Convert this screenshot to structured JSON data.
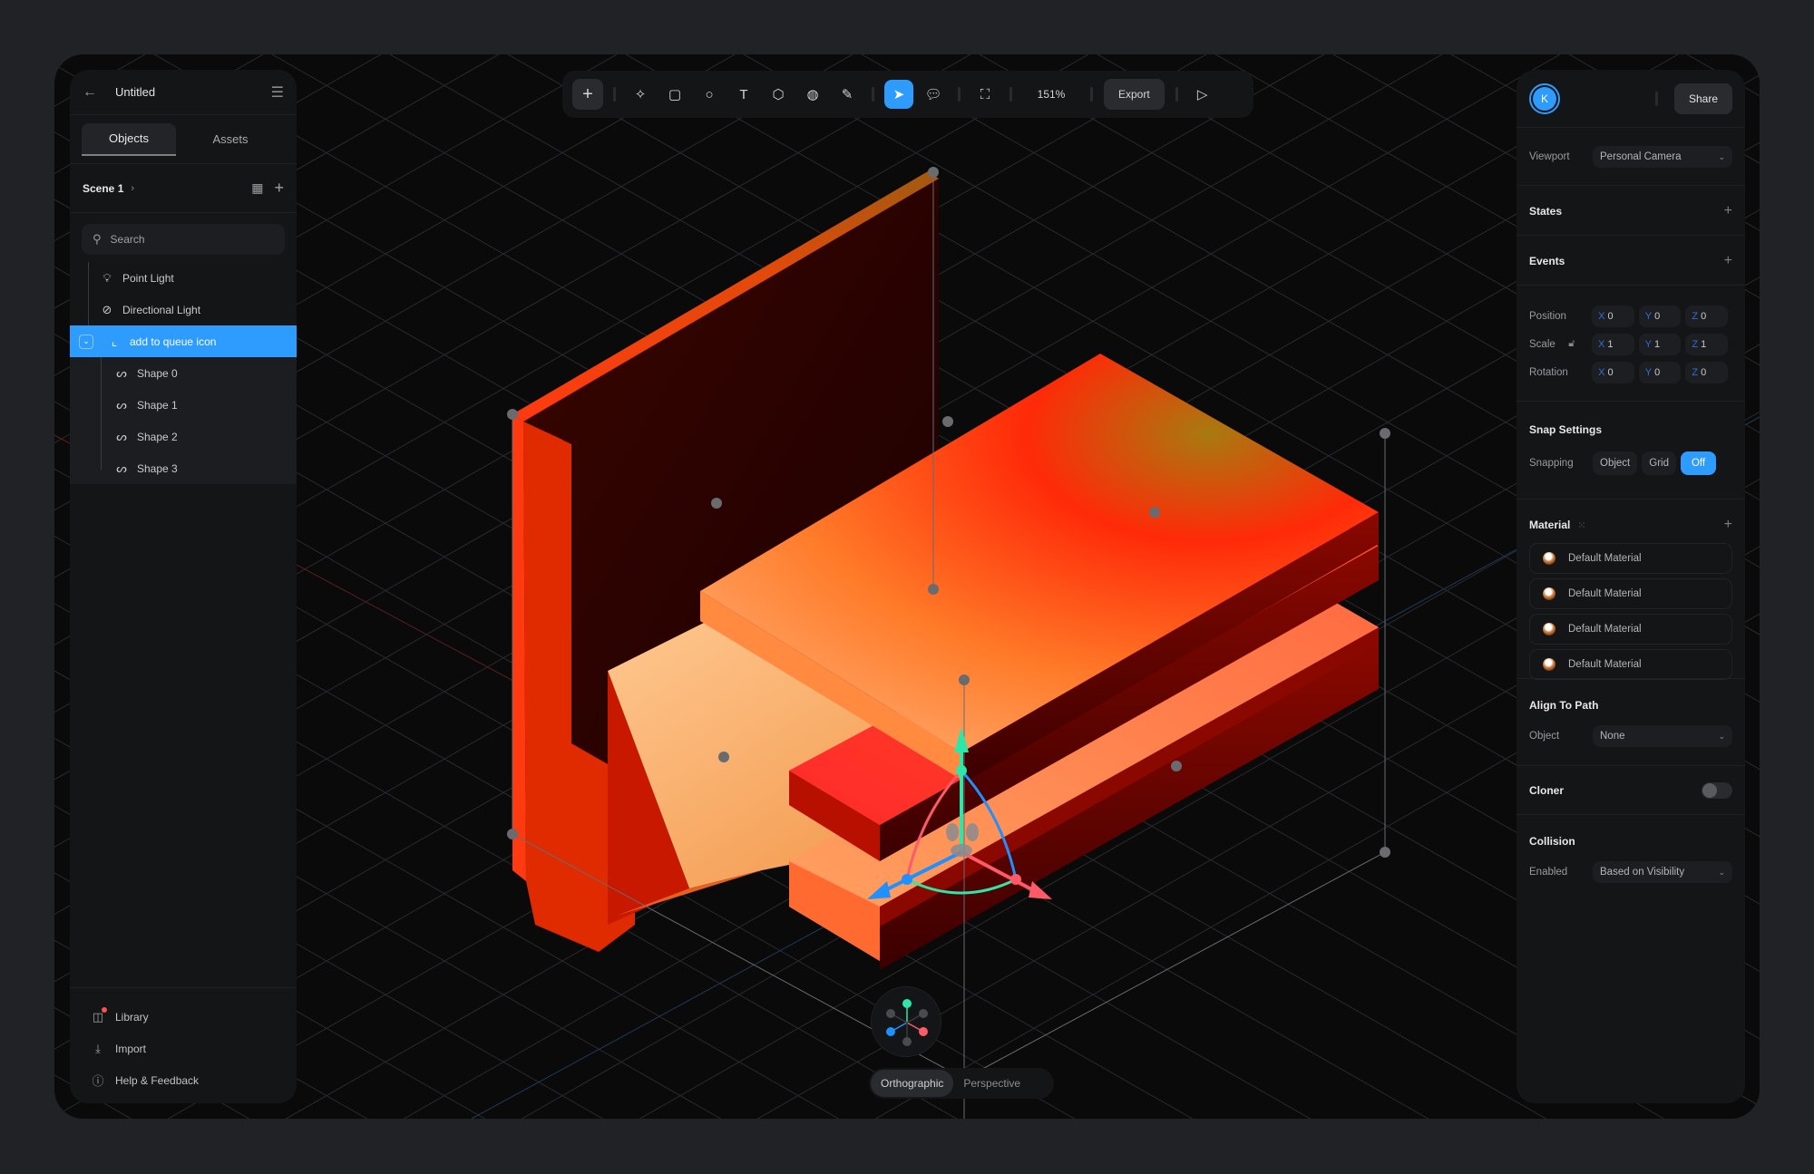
{
  "document": {
    "title": "Untitled"
  },
  "left_panel": {
    "tabs": [
      {
        "label": "Objects",
        "active": true
      },
      {
        "label": "Assets",
        "active": false
      }
    ],
    "scene": {
      "label": "Scene 1"
    },
    "search": {
      "placeholder": "Search",
      "value": ""
    },
    "tree": [
      {
        "label": "Point Light",
        "icon": "lightbulb-icon"
      },
      {
        "label": "Directional Light",
        "icon": "directional-light-icon"
      },
      {
        "label": "add to queue icon",
        "icon": "group-icon",
        "selected": true,
        "expanded": true,
        "children": [
          {
            "label": "Shape 0",
            "icon": "path-icon"
          },
          {
            "label": "Shape 1",
            "icon": "path-icon"
          },
          {
            "label": "Shape 2",
            "icon": "path-icon"
          },
          {
            "label": "Shape 3",
            "icon": "path-icon"
          }
        ]
      }
    ],
    "footer": [
      {
        "label": "Library",
        "icon": "library-icon",
        "notification": true
      },
      {
        "label": "Import",
        "icon": "import-icon"
      },
      {
        "label": "Help & Feedback",
        "icon": "help-icon"
      }
    ]
  },
  "toolbar": {
    "tools": [
      {
        "name": "add",
        "icon": "plus-icon"
      },
      {
        "name": "ai-generate",
        "icon": "sparkle-icon"
      },
      {
        "name": "rectangle",
        "icon": "rectangle-icon"
      },
      {
        "name": "ellipse",
        "icon": "ellipse-icon"
      },
      {
        "name": "text",
        "icon": "text-icon"
      },
      {
        "name": "cube",
        "icon": "cube-icon"
      },
      {
        "name": "sphere",
        "icon": "sphere-icon"
      },
      {
        "name": "pen",
        "icon": "pen-icon"
      },
      {
        "name": "select",
        "icon": "cursor-icon",
        "active": true
      },
      {
        "name": "comment",
        "icon": "comment-icon"
      },
      {
        "name": "frame",
        "icon": "frame-icon"
      }
    ],
    "zoom_level": "151%",
    "export_label": "Export",
    "play_icon": "play-icon"
  },
  "right_panel": {
    "avatar_initial": "K",
    "share_label": "Share",
    "viewport": {
      "label": "Viewport",
      "value": "Personal Camera"
    },
    "states": {
      "title": "States"
    },
    "events": {
      "title": "Events"
    },
    "transform": {
      "position": {
        "label": "Position",
        "x": "0",
        "y": "0",
        "z": "0"
      },
      "scale": {
        "label": "Scale",
        "x": "1",
        "y": "1",
        "z": "1"
      },
      "rotation": {
        "label": "Rotation",
        "x": "0",
        "y": "0",
        "z": "0"
      },
      "axes": {
        "x": "X",
        "y": "Y",
        "z": "Z"
      }
    },
    "snap": {
      "title": "Snap Settings",
      "label": "Snapping",
      "options": [
        "Object",
        "Grid",
        "Off"
      ],
      "selected": "Off"
    },
    "material": {
      "title": "Material",
      "items": [
        "Default Material",
        "Default Material",
        "Default Material",
        "Default Material"
      ]
    },
    "align_to_path": {
      "title": "Align To Path",
      "label": "Object",
      "value": "None"
    },
    "cloner": {
      "title": "Cloner",
      "enabled": false
    },
    "collision": {
      "title": "Collision",
      "label": "Enabled",
      "value": "Based on Visibility"
    }
  },
  "viewport_controls": {
    "projection_options": [
      "Orthographic",
      "Perspective"
    ],
    "projection_selected": "Orthographic"
  },
  "colors": {
    "accent": "#2e9bff",
    "axis_x": "#ff5a67",
    "axis_y": "#2ee6a8",
    "axis_z": "#1e90ff",
    "object_primary": "#ff3a10",
    "object_highlight": "#ffb070"
  }
}
